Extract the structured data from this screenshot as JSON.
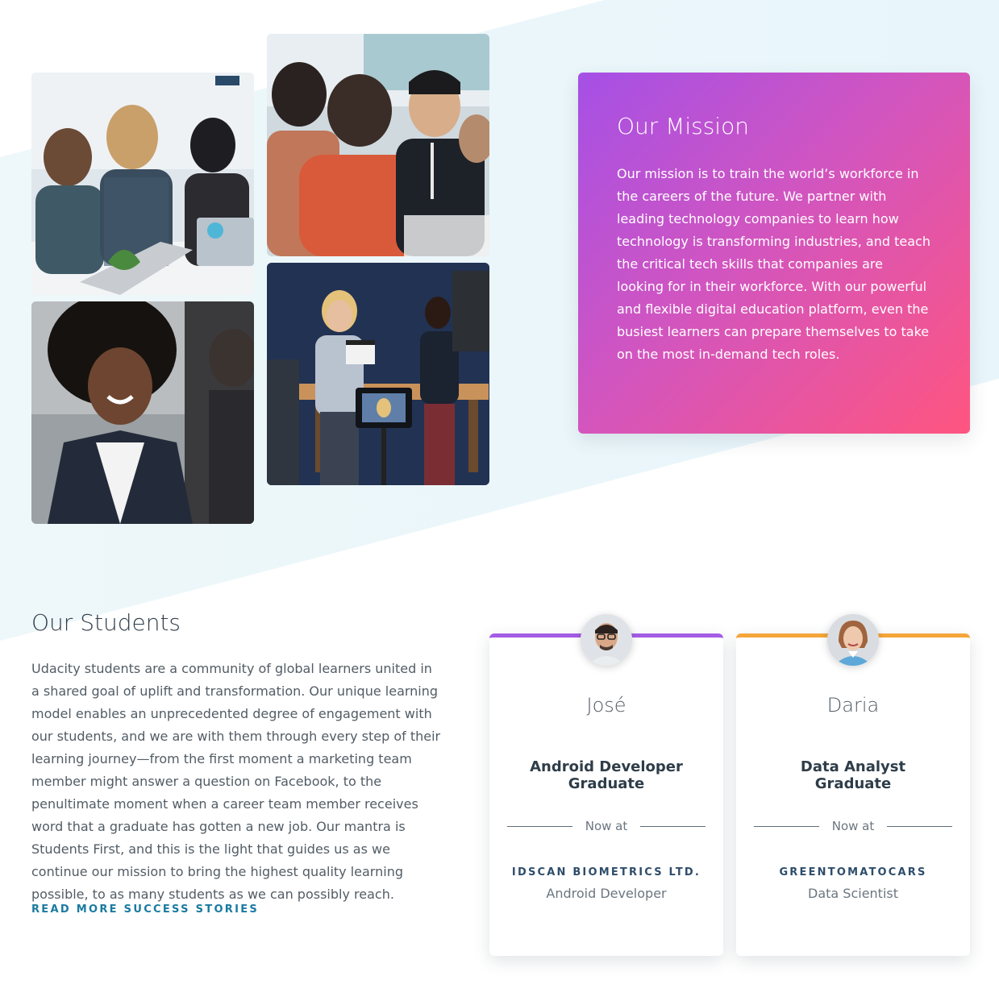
{
  "mission": {
    "title": "Our Mission",
    "body": "Our mission is to train the world’s workforce in the careers of the future. We partner with leading technology companies to learn how technology is transforming industries, and teach the critical tech skills that companies are looking for in their workforce. With our powerful and flexible digital education platform, even the busiest learners can prepare themselves to take on the most in-demand tech roles."
  },
  "students": {
    "title": "Our Students",
    "body": "Udacity students are a community of global learners united in a shared goal of uplift and transformation. Our unique learning model enables an unprecedented degree of engagement with our students, and we are with them through every step of their learning journey—from the first moment a marketing team member might answer a question on Facebook, to the penultimate moment when a career team member receives word that a graduate has gotten a new job. Our mantra is Students First, and this is the light that guides us as we continue our mission to bring the highest quality learning possible, to as many students as we can possibly reach.",
    "read_more": "READ MORE SUCCESS STORIES"
  },
  "stories": [
    {
      "name": "José",
      "program": "Android Developer Graduate",
      "now_at": "Now at",
      "company": "IDSCAN BIOMETRICS LTD.",
      "role": "Android Developer",
      "accent": "#a45ce6"
    },
    {
      "name": "Daria",
      "program": "Data Analyst Graduate",
      "now_at": "Now at",
      "company": "GREENTOMATOCARS",
      "role": "Data Scientist",
      "accent": "#f5a53a"
    }
  ],
  "colors": {
    "mission_gradient_start": "#a550e6",
    "mission_gradient_end": "#ff5580",
    "link": "#1a7aa0"
  }
}
